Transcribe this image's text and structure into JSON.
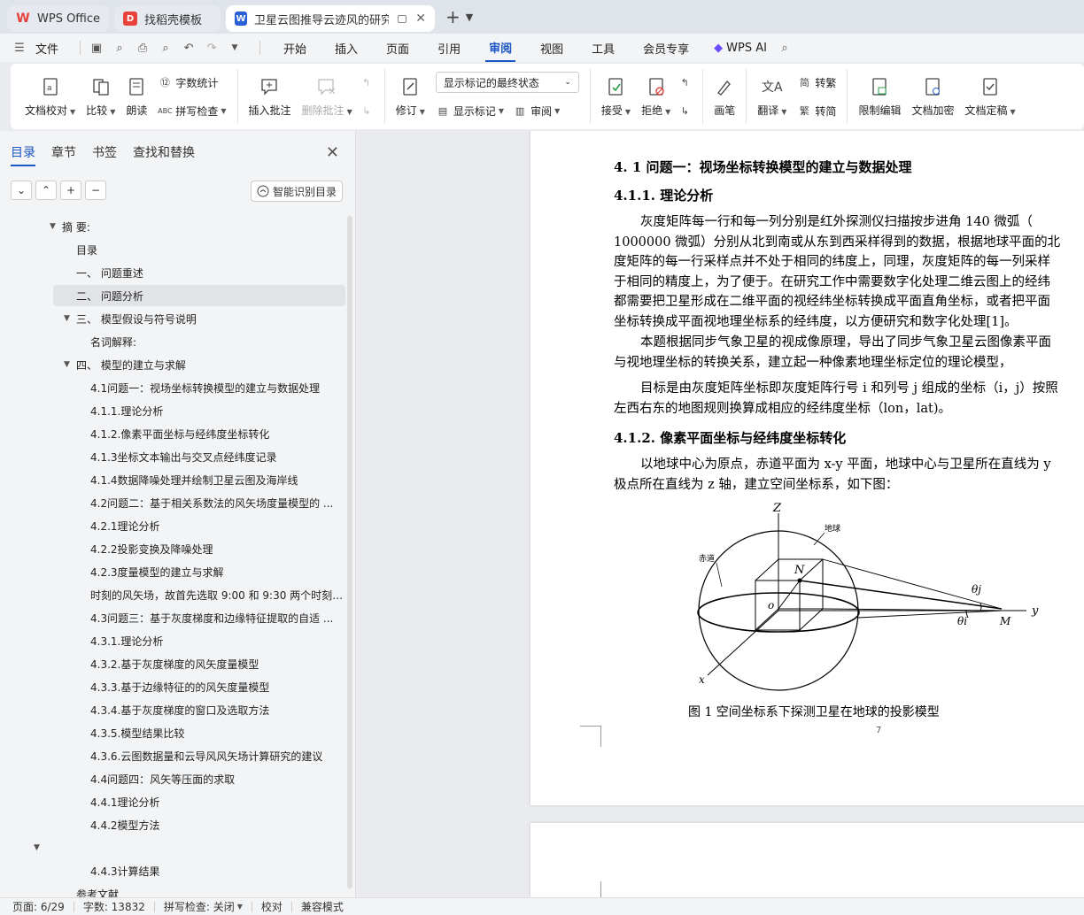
{
  "tabs": [
    {
      "label": "WPS Office",
      "icon": "wps-logo-icon",
      "color": "#e8403a"
    },
    {
      "label": "找稻壳模板",
      "icon": "docer-icon",
      "color": "#e8403a"
    },
    {
      "label": "卫星云图推导云迹风的研究 毕",
      "icon": "word-doc-icon",
      "color": "#2b5fd9",
      "active": true
    }
  ],
  "menu": {
    "file_label": "文件",
    "tabs": [
      "开始",
      "插入",
      "页面",
      "引用",
      "审阅",
      "视图",
      "工具",
      "会员专享"
    ],
    "active_tab": "审阅",
    "wps_ai_label": "WPS AI"
  },
  "ribbon": {
    "doc_check": "文档校对",
    "compare": "比较",
    "read_aloud": "朗读",
    "word_count": "字数统计",
    "spell_check": "拼写检查",
    "insert_comment": "插入批注",
    "delete_comment": "删除批注",
    "track_changes": "修订",
    "markup_state": "显示标记的最终状态",
    "show_markup": "显示标记",
    "review": "审阅",
    "accept": "接受",
    "reject": "拒绝",
    "pen": "画笔",
    "translate": "翻译",
    "to_traditional": "转繁",
    "to_simplified": "转简",
    "restrict_edit": "限制编辑",
    "encrypt_doc": "文档加密",
    "finalize_doc": "文档定稿"
  },
  "nav": {
    "tabs": [
      "目录",
      "章节",
      "书签",
      "查找和替换"
    ],
    "active_tab": "目录",
    "smart_toc_label": "智能识别目录",
    "toc": [
      {
        "text": "摘 要:",
        "level": 0,
        "caret": "down"
      },
      {
        "text": "目录",
        "level": 1
      },
      {
        "text": "一、 问题重述",
        "level": 1
      },
      {
        "text": "二、 问题分析",
        "level": 1,
        "selected": true
      },
      {
        "text": "三、 模型假设与符号说明",
        "level": 1,
        "caret": "down"
      },
      {
        "text": "名词解释:",
        "level": 2
      },
      {
        "text": "四、 模型的建立与求解",
        "level": 1,
        "caret": "down"
      },
      {
        "text": "4.1问题一：视场坐标转换模型的建立与数据处理",
        "level": 2
      },
      {
        "text": "4.1.1.理论分析",
        "level": 2
      },
      {
        "text": "4.1.2.像素平面坐标与经纬度坐标转化",
        "level": 2
      },
      {
        "text": "4.1.3坐标文本输出与交叉点经纬度记录",
        "level": 2
      },
      {
        "text": "4.1.4数据降噪处理并绘制卫星云图及海岸线",
        "level": 2
      },
      {
        "text": "4.2问题二：基于相关系数法的风矢场度量模型的 ...",
        "level": 2
      },
      {
        "text": "4.2.1理论分析",
        "level": 2
      },
      {
        "text": "4.2.2投影变换及降噪处理",
        "level": 2
      },
      {
        "text": "4.2.3度量模型的建立与求解",
        "level": 2
      },
      {
        "text": "时刻的风矢场，故首先选取 9:00 和 9:30 两个时刻 ...",
        "level": 2
      },
      {
        "text": "4.3问题三：基于灰度梯度和边缘特征提取的自适 ...",
        "level": 2
      },
      {
        "text": "4.3.1.理论分析",
        "level": 2
      },
      {
        "text": "4.3.2.基于灰度梯度的风矢度量模型",
        "level": 2
      },
      {
        "text": "4.3.3.基于边缘特征的的风矢度量模型",
        "level": 2
      },
      {
        "text": "4.3.4.基于灰度梯度的窗口及选取方法",
        "level": 2
      },
      {
        "text": "4.3.5.模型结果比较",
        "level": 2
      },
      {
        "text": "4.3.6.云图数据量和云导风风矢场计算研究的建议",
        "level": 2
      },
      {
        "text": "4.4问题四：风矢等压面的求取",
        "level": 2
      },
      {
        "text": "4.4.1理论分析",
        "level": 2
      },
      {
        "text": "4.4.2模型方法",
        "level": 2
      },
      {
        "text": "",
        "level": -1,
        "caret": "down"
      },
      {
        "text": "4.4.3计算结果",
        "level": 2
      },
      {
        "text": "参考文献",
        "level": 1
      }
    ]
  },
  "document": {
    "heading_4_1": "4. 1  问题一：视场坐标转换模型的建立与数据处理",
    "heading_4_1_1": "4.1.1.  理论分析",
    "para1": [
      "灰度矩阵每一行和每一列分别是红外探测仪扫描按步进角  140 微弧（",
      "1000000 微弧）分别从北到南或从东到西采样得到的数据，根据地球平面的北",
      "度矩阵的每一行采样点并不处于相同的纬度上，同理，灰度矩阵的每一列采样",
      "于相同的精度上，为了便于。在研究工作中需要数字化处理二维云图上的经纬",
      "都需要把卫星形成在二维平面的视经纬坐标转换成平面直角坐标，或者把平面",
      "坐标转换成平面视地理坐标系的经纬度，以方便研究和数字化处理[1]。"
    ],
    "para2": [
      "本题根据同步气象卫星的视成像原理，导出了同步气象卫星云图像素平面",
      "与视地理坐标的转换关系，建立起一种像素地理坐标定位的理论模型，"
    ],
    "para3": [
      "目标是由灰度矩阵坐标即灰度矩阵行号  i 和列号  j 组成的坐标（i，j）按照",
      "左西右东的地图规则换算成相应的经纬度坐标（lon，lat)。"
    ],
    "heading_4_1_2": "4.1.2.  像素平面坐标与经纬度坐标转化",
    "para4": [
      "以地球中心为原点，赤道平面为  x-y 平面，地球中心与卫星所在直线为  y",
      "极点所在直线为  z 轴，建立空间坐标系，如下图："
    ],
    "figure_labels": {
      "z": "Z",
      "y": "y",
      "x": "x",
      "o": "o",
      "n": "N",
      "m": "M",
      "theta_j": "θj",
      "theta_i": "θi",
      "earth": "地球",
      "equator": "赤道"
    },
    "figure_caption": "图 1   空间坐标系下探测卫星在地球的投影模型",
    "page_number": "7"
  },
  "status": {
    "page": "页面: 6/29",
    "words": "字数: 13832",
    "spell": "拼写检查: 关闭",
    "proofread": "校对",
    "compat": "兼容模式"
  },
  "colors": {
    "accent": "#1a56c4",
    "wps_red": "#e8403a",
    "ai_purple": "#6b4cff"
  }
}
